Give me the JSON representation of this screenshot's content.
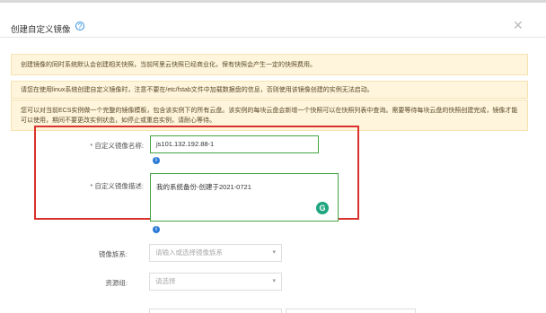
{
  "dialog": {
    "title": "创建自定义镜像",
    "help_icon": "?",
    "close_icon": "✕"
  },
  "notices": [
    "创建镜像的同时系统默认会创建相关快照，当前阿里云快照已经商业化，保有快照会产生一定的快照费用。",
    "请您在使用linux系统创建自定义镜像时，注意不要在/etc/fstab文件中加载数据盘的信息，否则使用该镜像创建的实例无法启动。",
    "您可以对当前ECS实例做一个完整的镜像模板，包含该实例下的所有云盘。该实例的每块云盘会新增一个快照可以在快照列表中查询。需要等待每块云盘的快照创建完成，镜像才能可以使用，期间不要更改实例状态，如停止或重启实例，请耐心等待。"
  ],
  "form": {
    "name_label": "* 自定义镜像名称:",
    "name_value": "js101.132.192.88-1",
    "desc_label": "* 自定义镜像描述:",
    "desc_value": "我的系统备份-创建于2021-0721",
    "family_label": "镜像族系:",
    "family_placeholder": "请输入或选择镜像族系",
    "resource_label": "资源组:",
    "resource_placeholder": "请选择"
  },
  "icons": {
    "info": "i",
    "grammarly": "G",
    "caret": "▾"
  },
  "colors": {
    "highlight_border": "#d9312b",
    "input_border": "#44a544",
    "notice_bg": "#fff5dc",
    "info_blue": "#2c7ad6",
    "grammarly_green": "#1fa57f"
  }
}
